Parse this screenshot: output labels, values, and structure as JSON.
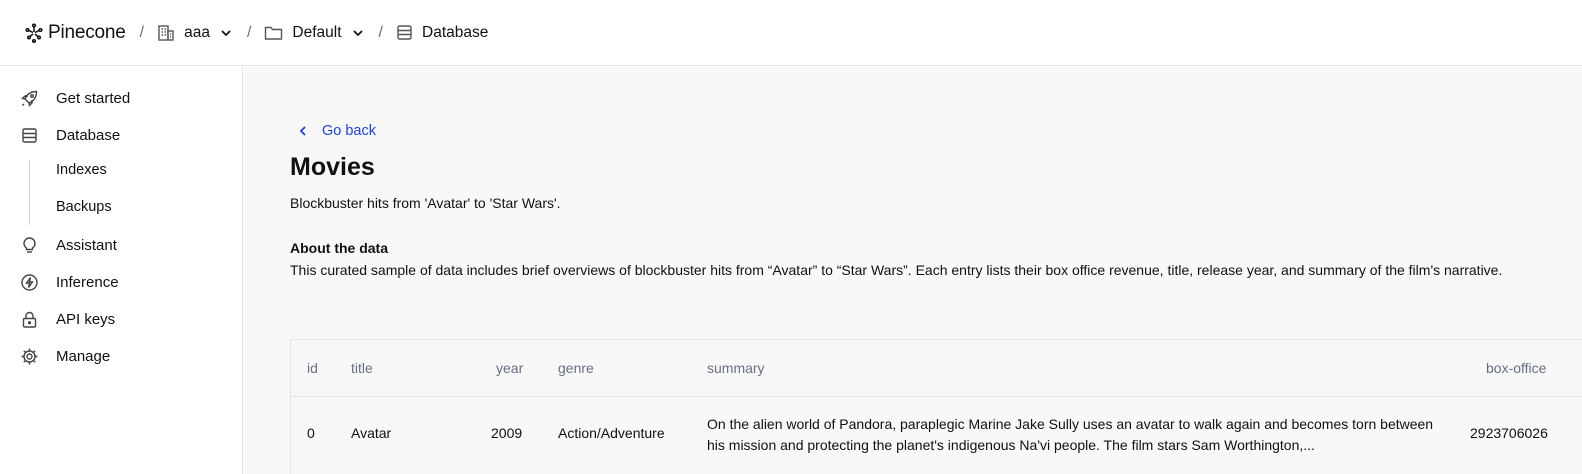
{
  "header": {
    "logo_text": "Pinecone",
    "separators": [
      "/",
      "/",
      "/"
    ],
    "breadcrumbs": [
      {
        "label": "aaa",
        "icon": "building-icon",
        "has_dropdown": true
      },
      {
        "label": "Default",
        "icon": "folder-icon",
        "has_dropdown": true
      },
      {
        "label": "Database",
        "icon": "database-icon",
        "has_dropdown": false
      }
    ]
  },
  "sidebar": {
    "items": [
      {
        "label": "Get started",
        "icon": "rocket-icon"
      },
      {
        "label": "Database",
        "icon": "database-icon"
      },
      {
        "label": "Assistant",
        "icon": "lightbulb-icon"
      },
      {
        "label": "Inference",
        "icon": "bolt-icon"
      },
      {
        "label": "API keys",
        "icon": "lock-icon"
      },
      {
        "label": "Manage",
        "icon": "gear-icon"
      }
    ],
    "sub_items": [
      "Indexes",
      "Backups"
    ]
  },
  "main": {
    "go_back": "Go back",
    "title": "Movies",
    "subtitle": "Blockbuster hits from 'Avatar' to 'Star Wars'.",
    "about_heading": "About the data",
    "about_text": "This curated sample of data includes brief overviews of blockbuster hits from “Avatar” to “Star Wars”. Each entry lists their box office revenue, title, release year, and summary of the film's narrative."
  },
  "table": {
    "columns": [
      "id",
      "title",
      "year",
      "genre",
      "summary",
      "box-office"
    ],
    "rows": [
      {
        "id": "0",
        "title": "Avatar",
        "year": "2009",
        "genre": "Action/Adventure",
        "summary": "On the alien world of Pandora, paraplegic Marine Jake Sully uses an avatar to walk again and becomes torn between his mission and protecting the planet's indigenous Na'vi people. The film stars Sam Worthington,...",
        "box_office": "2923706026"
      }
    ]
  },
  "colors": {
    "link": "#1e40e6",
    "border": "#e4e4e7",
    "main_bg": "#f8f8f8",
    "header_text_muted": "#667085"
  }
}
